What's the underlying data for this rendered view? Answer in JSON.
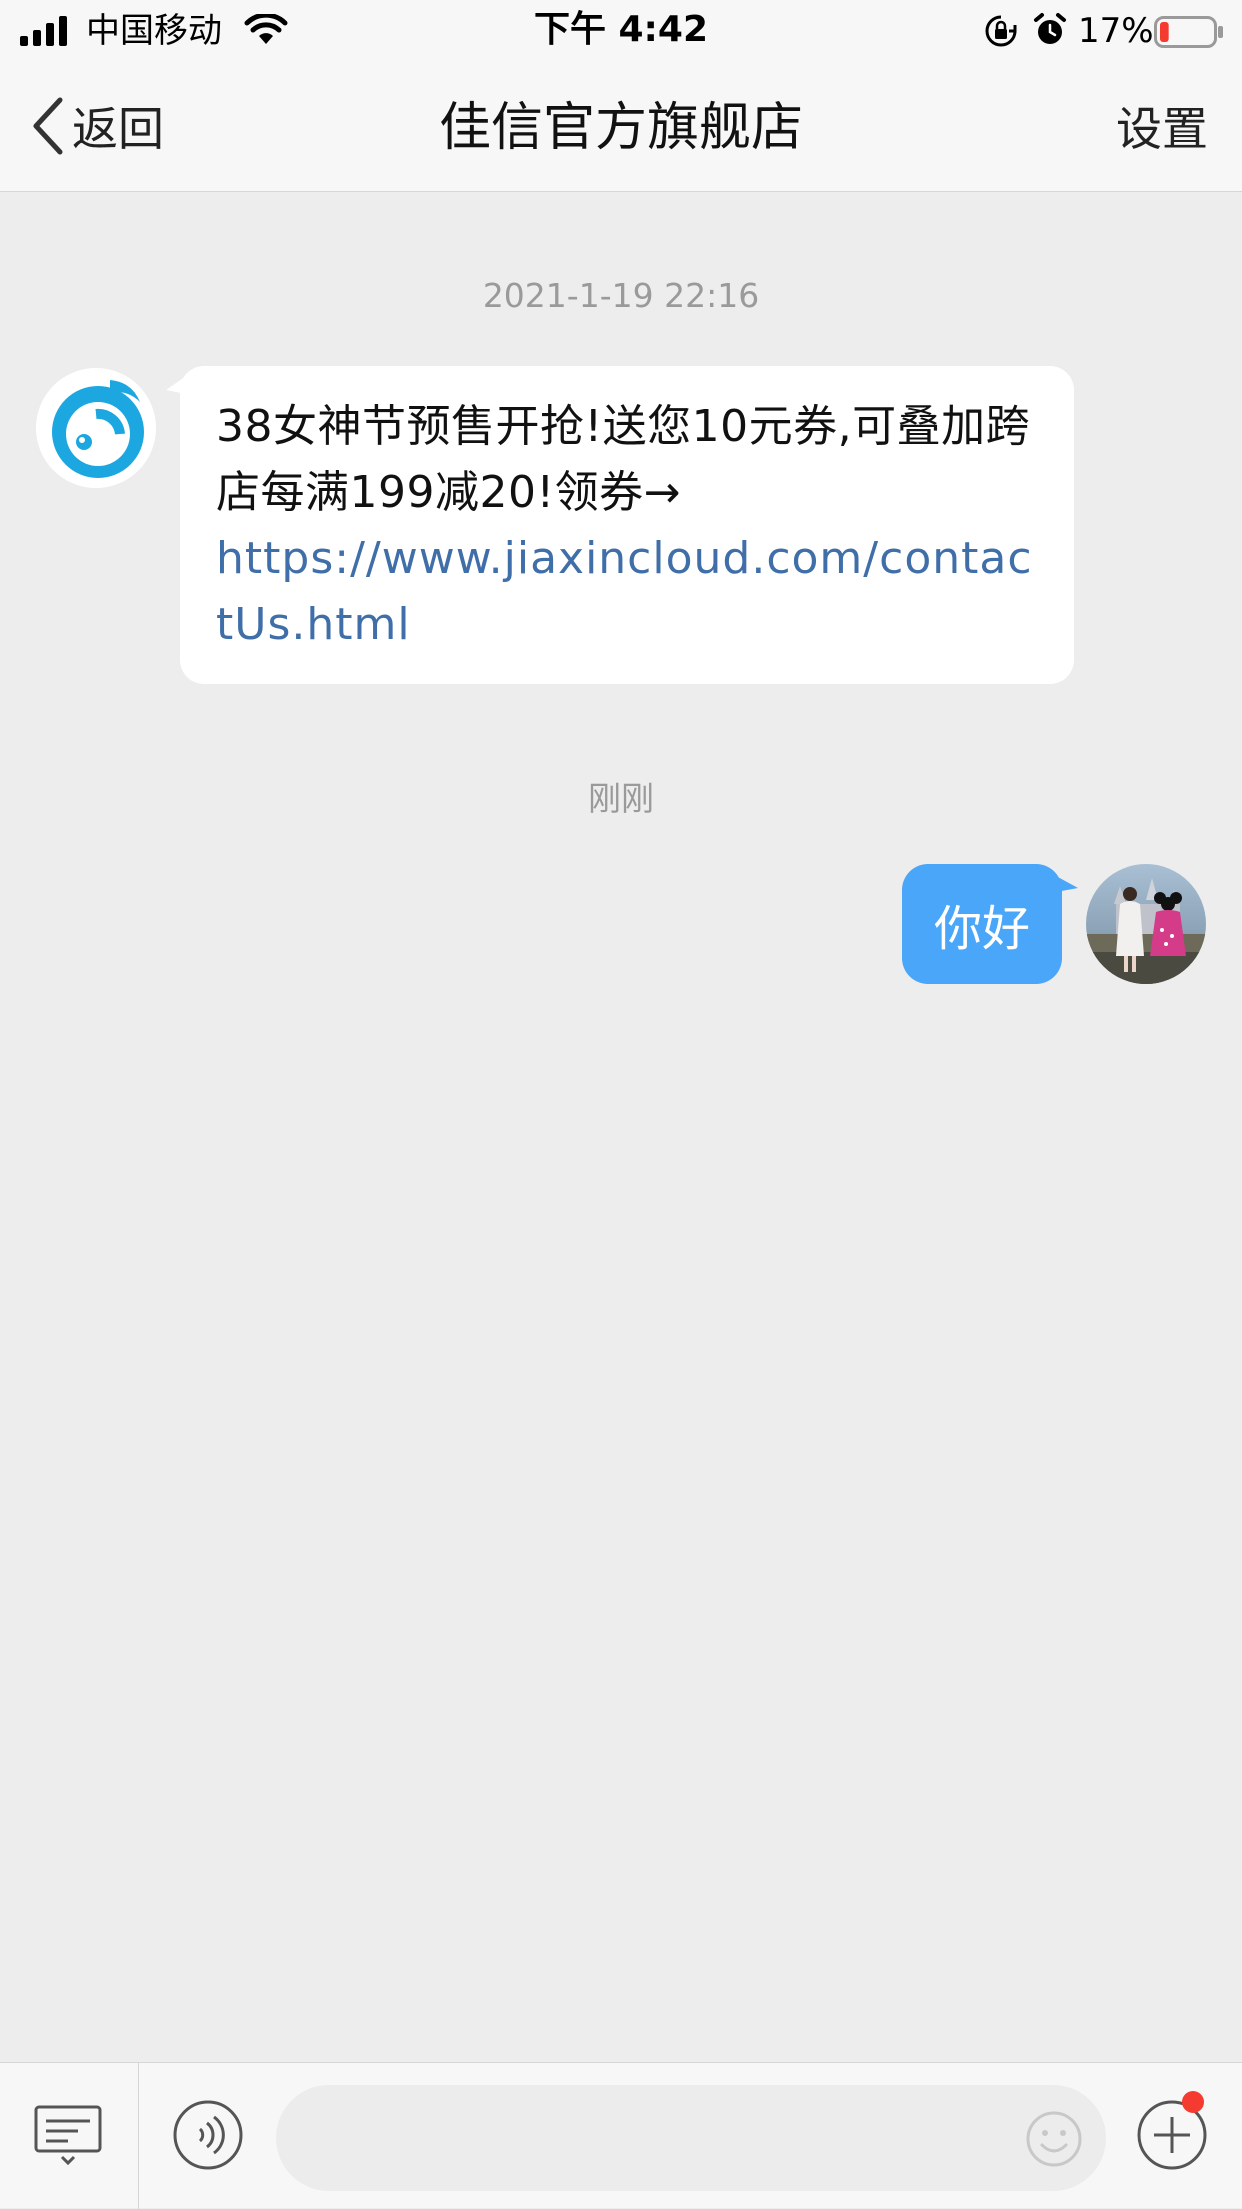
{
  "status_bar": {
    "carrier": "中国移动",
    "time": "下午 4:42",
    "battery_percent": "17%",
    "battery_level": 0.17,
    "icons": [
      "signal-icon",
      "wifi-icon",
      "orientation-lock-icon",
      "alarm-icon",
      "battery-icon"
    ]
  },
  "nav": {
    "back_label": "返回",
    "title": "佳信官方旗舰店",
    "settings_label": "设置"
  },
  "chat": {
    "messages": [
      {
        "timestamp": "2021-1-19 22:16",
        "from": "shop",
        "text": "38女神节预售开抢!送您10元券,可叠加跨店每满199减20!领券→",
        "link": "https://www.jiaxincloud.com/contactUs.html"
      },
      {
        "timestamp": "刚刚",
        "from": "me",
        "text": "你好"
      }
    ]
  },
  "input_bar": {
    "placeholder": "",
    "has_notification_dot": true
  },
  "colors": {
    "background": "#ededed",
    "bar": "#f7f7f7",
    "outgoing_bubble": "#4aa6f8",
    "link": "#3f6ea8",
    "shop_logo": "#1da7e0",
    "notification_dot": "#f53b30"
  }
}
